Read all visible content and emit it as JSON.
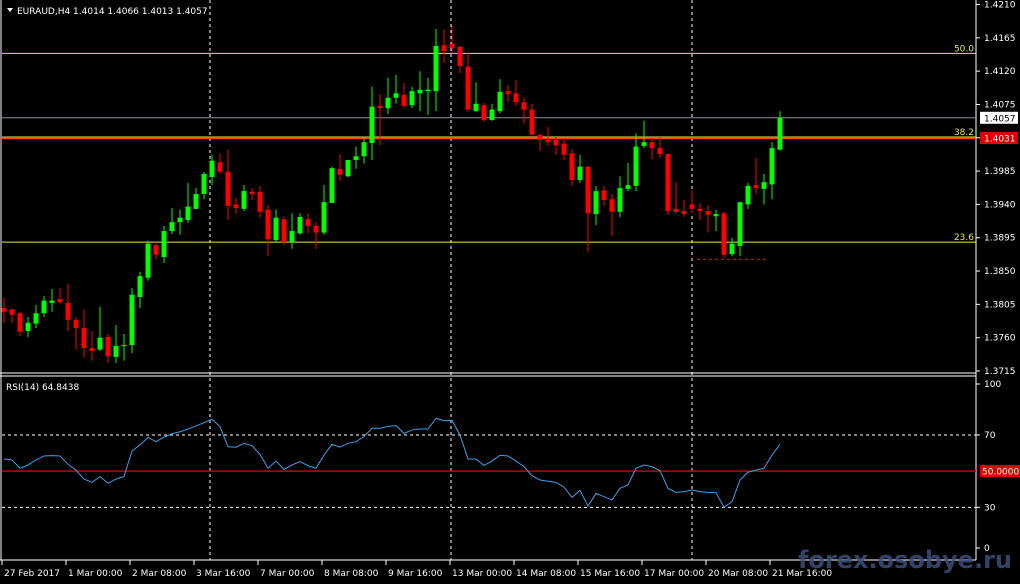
{
  "header": {
    "symbol_info": "EURAUD,H4  1.4014 1.4066 1.4013 1.4057"
  },
  "watermark": "forex.osobye.ru",
  "colors": {
    "background": "#000000",
    "bull": "#00ff00",
    "bear": "#ff0000",
    "rsi_line": "#3ca0e6",
    "fib_level": "#e8e84a",
    "current_price_line": "#8c8c9c",
    "level_line": "#ff4500",
    "grid": "#ffffff"
  },
  "chart_data": [
    {
      "type": "candlestick",
      "title": "EURAUD,H4",
      "ohlc_header": {
        "open": 1.4014,
        "high": 1.4066,
        "low": 1.4013,
        "close": 1.4057
      },
      "ylim": [
        1.3715,
        1.421
      ],
      "y_ticks": [
        "1.4210",
        "1.4165",
        "1.4120",
        "1.4075",
        "1.4057",
        "1.4031",
        "1.3985",
        "1.3940",
        "1.3895",
        "1.3850",
        "1.3805",
        "1.3760",
        "1.3715"
      ],
      "y_tick_values": [
        1.421,
        1.4165,
        1.412,
        1.4075,
        1.403,
        1.3985,
        1.394,
        1.3895,
        1.385,
        1.3805,
        1.376,
        1.3715
      ],
      "x_labels": [
        "27 Feb 2017",
        "1 Mar 00:00",
        "2 Mar 08:00",
        "3 Mar 16:00",
        "7 Mar 00:00",
        "8 Mar 08:00",
        "9 Mar 16:00",
        "13 Mar 00:00",
        "14 Mar 08:00",
        "15 Mar 16:00",
        "17 Mar 00:00",
        "20 Mar 08:00",
        "21 Mar 16:00"
      ],
      "price_labels": {
        "current": "1.4057",
        "level": "1.4031"
      },
      "horizontal_levels": [
        {
          "label": "50.0",
          "value": 1.4144,
          "color": "#e8e84a"
        },
        {
          "label": "38.2",
          "value": 1.4031,
          "color": "#e8e84a"
        },
        {
          "label": "23.6",
          "value": 1.3889,
          "color": "#e8e84a"
        }
      ],
      "current_price_line": 1.4057,
      "level_line": 1.4031,
      "support_dashed": {
        "value": 1.3866,
        "from_bar": 87,
        "to_bar": 95
      },
      "candles_ohlc": [
        [
          1.38,
          1.3814,
          1.378,
          1.3795
        ],
        [
          1.3798,
          1.38,
          1.378,
          1.3791
        ],
        [
          1.3793,
          1.3795,
          1.3762,
          1.3768
        ],
        [
          1.3769,
          1.3788,
          1.3761,
          1.378
        ],
        [
          1.3779,
          1.3804,
          1.3773,
          1.3793
        ],
        [
          1.3793,
          1.3816,
          1.3788,
          1.381
        ],
        [
          1.3807,
          1.3826,
          1.3795,
          1.381
        ],
        [
          1.3812,
          1.3827,
          1.3806,
          1.3808
        ],
        [
          1.3807,
          1.3833,
          1.3769,
          1.3784
        ],
        [
          1.3784,
          1.3788,
          1.3744,
          1.3773
        ],
        [
          1.3773,
          1.3798,
          1.3733,
          1.3746
        ],
        [
          1.3746,
          1.3769,
          1.3729,
          1.3742
        ],
        [
          1.3744,
          1.3802,
          1.3742,
          1.376
        ],
        [
          1.3761,
          1.3765,
          1.3726,
          1.3735
        ],
        [
          1.3734,
          1.3777,
          1.3726,
          1.3749
        ],
        [
          1.3749,
          1.3765,
          1.3729,
          1.375
        ],
        [
          1.375,
          1.3827,
          1.3739,
          1.3818
        ],
        [
          1.3815,
          1.3849,
          1.38,
          1.3843
        ],
        [
          1.3841,
          1.3891,
          1.3837,
          1.3887
        ],
        [
          1.3885,
          1.3887,
          1.3866,
          1.3872
        ],
        [
          1.3869,
          1.3911,
          1.3861,
          1.3904
        ],
        [
          1.3904,
          1.3935,
          1.39,
          1.3916
        ],
        [
          1.3916,
          1.3933,
          1.3899,
          1.3922
        ],
        [
          1.3919,
          1.3969,
          1.3915,
          1.3937
        ],
        [
          1.3934,
          1.3962,
          1.3934,
          1.3954
        ],
        [
          1.3954,
          1.3984,
          1.3947,
          1.3981
        ],
        [
          1.3977,
          1.4007,
          1.3966,
          1.3999
        ],
        [
          1.3997,
          1.4009,
          1.3981,
          1.3984
        ],
        [
          1.3984,
          1.4014,
          1.3919,
          1.3938
        ],
        [
          1.394,
          1.3949,
          1.3927,
          1.3935
        ],
        [
          1.3934,
          1.3966,
          1.3931,
          1.3958
        ],
        [
          1.3957,
          1.3962,
          1.3946,
          1.3954
        ],
        [
          1.3957,
          1.3965,
          1.3922,
          1.393
        ],
        [
          1.3933,
          1.3939,
          1.387,
          1.3893
        ],
        [
          1.3892,
          1.3933,
          1.3889,
          1.3922
        ],
        [
          1.392,
          1.3924,
          1.3885,
          1.3889
        ],
        [
          1.3889,
          1.3928,
          1.388,
          1.3904
        ],
        [
          1.3901,
          1.3928,
          1.3899,
          1.3923
        ],
        [
          1.392,
          1.3928,
          1.3901,
          1.3911
        ],
        [
          1.3911,
          1.3916,
          1.388,
          1.3902
        ],
        [
          1.3902,
          1.3966,
          1.3899,
          1.3943
        ],
        [
          1.3942,
          1.3991,
          1.3942,
          1.3989
        ],
        [
          1.3988,
          1.4008,
          1.3972,
          1.398
        ],
        [
          1.3978,
          1.4,
          1.3977,
          1.4
        ],
        [
          1.4,
          1.4018,
          1.3988,
          1.4005
        ],
        [
          1.4005,
          1.4031,
          1.3995,
          1.4024
        ],
        [
          1.4023,
          1.4099,
          1.4,
          1.4072
        ],
        [
          1.4073,
          1.4089,
          1.402,
          1.407
        ],
        [
          1.407,
          1.4111,
          1.4062,
          1.4084
        ],
        [
          1.4084,
          1.4115,
          1.4076,
          1.409
        ],
        [
          1.4088,
          1.4104,
          1.407,
          1.4073
        ],
        [
          1.4074,
          1.4099,
          1.407,
          1.4093
        ],
        [
          1.409,
          1.412,
          1.4066,
          1.4095
        ],
        [
          1.4093,
          1.4111,
          1.4061,
          1.4095
        ],
        [
          1.4093,
          1.4177,
          1.4066,
          1.4154
        ],
        [
          1.4155,
          1.4176,
          1.4131,
          1.4147
        ],
        [
          1.4157,
          1.4181,
          1.4144,
          1.4151
        ],
        [
          1.4153,
          1.4154,
          1.4117,
          1.4127
        ],
        [
          1.4126,
          1.4144,
          1.4065,
          1.4068
        ],
        [
          1.4066,
          1.4105,
          1.4065,
          1.4076
        ],
        [
          1.4074,
          1.4077,
          1.4051,
          1.4054
        ],
        [
          1.4054,
          1.4076,
          1.4053,
          1.4068
        ],
        [
          1.4066,
          1.4109,
          1.4063,
          1.4092
        ],
        [
          1.4093,
          1.4101,
          1.4078,
          1.4089
        ],
        [
          1.409,
          1.4108,
          1.4073,
          1.4078
        ],
        [
          1.4078,
          1.4084,
          1.4049,
          1.4068
        ],
        [
          1.4068,
          1.4076,
          1.4034,
          1.4034
        ],
        [
          1.4034,
          1.4036,
          1.4012,
          1.4027
        ],
        [
          1.4027,
          1.4045,
          1.4019,
          1.4024
        ],
        [
          1.4027,
          1.4031,
          1.4007,
          1.402
        ],
        [
          1.4022,
          1.403,
          1.4,
          1.4007
        ],
        [
          1.4009,
          1.4015,
          1.3965,
          1.3973
        ],
        [
          1.3973,
          1.4007,
          1.3969,
          1.3991
        ],
        [
          1.3991,
          1.3992,
          1.3876,
          1.3928
        ],
        [
          1.3927,
          1.3965,
          1.3912,
          1.3958
        ],
        [
          1.3959,
          1.3965,
          1.3938,
          1.3946
        ],
        [
          1.3947,
          1.3954,
          1.3897,
          1.393
        ],
        [
          1.393,
          1.3978,
          1.3923,
          1.3962
        ],
        [
          1.3961,
          1.3996,
          1.3958,
          1.3966
        ],
        [
          1.3965,
          1.4036,
          1.3958,
          1.4018
        ],
        [
          1.4019,
          1.4053,
          1.4016,
          1.4024
        ],
        [
          1.4024,
          1.403,
          1.4001,
          1.4016
        ],
        [
          1.4016,
          1.4031,
          1.4003,
          1.4008
        ],
        [
          1.4008,
          1.4009,
          1.3926,
          1.3931
        ],
        [
          1.3934,
          1.397,
          1.3927,
          1.393
        ],
        [
          1.3931,
          1.3946,
          1.3923,
          1.3927
        ],
        [
          1.394,
          1.3959,
          1.3928,
          1.3934
        ],
        [
          1.3934,
          1.3942,
          1.3919,
          1.3931
        ],
        [
          1.3931,
          1.3939,
          1.3902,
          1.3926
        ],
        [
          1.3924,
          1.3933,
          1.3904,
          1.3927
        ],
        [
          1.3928,
          1.393,
          1.3868,
          1.3872
        ],
        [
          1.3873,
          1.3895,
          1.387,
          1.3887
        ],
        [
          1.3884,
          1.3943,
          1.387,
          1.3943
        ],
        [
          1.394,
          1.3969,
          1.3934,
          1.3965
        ],
        [
          1.3966,
          1.4003,
          1.3954,
          1.3962
        ],
        [
          1.3961,
          1.3981,
          1.394,
          1.397
        ],
        [
          1.3967,
          1.4024,
          1.3947,
          1.4016
        ],
        [
          1.4014,
          1.4066,
          1.4013,
          1.4057
        ]
      ]
    },
    {
      "type": "line",
      "title": "RSI(14) 64.8438",
      "ylim": [
        0,
        100
      ],
      "y_ticks": [
        "100",
        "70",
        "30",
        "0"
      ],
      "y_tick_values": [
        100,
        70,
        30,
        0
      ],
      "levels": [
        70,
        30
      ],
      "mid_level": {
        "value": 50,
        "label": "50.0000"
      },
      "values": [
        56.7,
        56.2,
        51.6,
        53.4,
        56.2,
        58.4,
        58.6,
        58.4,
        53.8,
        50.6,
        45.6,
        43.8,
        47.0,
        43.3,
        45.6,
        47.0,
        61.2,
        64.5,
        68.7,
        66.3,
        68.9,
        70.7,
        71.8,
        73.3,
        75.0,
        76.8,
        78.7,
        74.6,
        63.5,
        63.2,
        65.4,
        64.1,
        59.3,
        51.6,
        55.6,
        51.0,
        53.4,
        55.3,
        53.0,
        51.6,
        58.9,
        64.8,
        63.3,
        65.4,
        66.3,
        69.1,
        73.7,
        73.7,
        74.8,
        75.2,
        70.9,
        72.8,
        73.3,
        73.3,
        79.2,
        77.9,
        78.1,
        70.0,
        56.7,
        56.7,
        53.2,
        55.6,
        58.8,
        58.4,
        55.6,
        52.5,
        47.5,
        45.1,
        44.4,
        43.8,
        41.2,
        35.5,
        39.4,
        30.7,
        37.7,
        35.9,
        34.1,
        40.5,
        42.4,
        51.6,
        53.4,
        52.5,
        50.3,
        40.5,
        38.3,
        38.7,
        39.6,
        38.7,
        38.3,
        38.1,
        30.0,
        33.1,
        45.1,
        49.4,
        50.6,
        51.6,
        58.9,
        64.8438
      ]
    }
  ]
}
